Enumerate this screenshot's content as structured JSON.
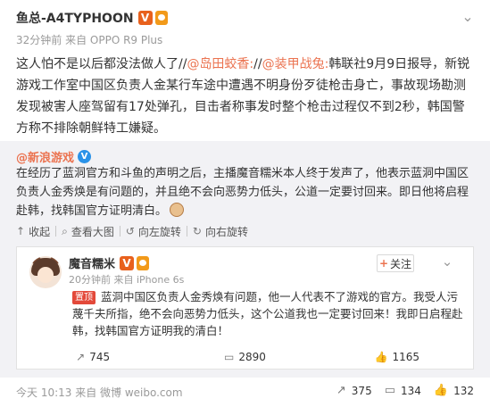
{
  "post": {
    "author": "鱼总-A4TYPHOON",
    "meta": "32分钟前 来自 OPPO R9 Plus",
    "text": {
      "intro": "这人怕不是以后都没法做人了//",
      "mention1": "@岛田蛟香:",
      "sep": "//",
      "mention2": "@装甲战兔:",
      "body": "韩联社9月9日报导，新锐游戏工作室中国区负责人金某行车途中遭遇不明身份歹徒枪击身亡，事故现场勘测发现被害人座驾留有17处弹孔，目击者称事发时整个枪击过程仅不到2秒，韩国警方称不排除朝鲜特工嫌疑。"
    }
  },
  "retweet": {
    "author": "@新浪游戏",
    "text": "在经历了蓝洞官方和斗鱼的声明之后，主播魔音糯米本人终于发声了，他表示蓝洞中国区负责人金秀焕是有问题的，并且绝不会向恶势力低头，公道一定要讨回来。即日他将启程赴韩，找韩国官方证明清白。",
    "toolbar": {
      "collapse": "收起",
      "view_large": "查看大图",
      "rotate_left": "向左旋转",
      "rotate_right": "向右旋转"
    },
    "embedded": {
      "author": "魔音糯米",
      "meta": "20分钟前 来自 iPhone 6s",
      "follow_label": "关注",
      "pinned_label": "置顶",
      "text": "蓝洞中国区负责人金秀焕有问题，他一人代表不了游戏的官方。我受人污蔑千夫所指，绝不会向恶势力低头，这个公道我也一定要讨回来！我即日启程赴韩，找韩国官方证明我的清白！",
      "actions": {
        "repost": "745",
        "comment": "2890",
        "like": "1165"
      }
    }
  },
  "footer": {
    "meta": "今天 10:13 来自 微博 weibo.com",
    "repost": "375",
    "comment": "134",
    "like": "132"
  },
  "icons": {
    "menu": "chevron-down-icon",
    "verified": "verified-v-icon",
    "vip": "vip-badge-icon",
    "repost": "repost-icon",
    "comment": "comment-icon",
    "like": "thumbs-up-icon"
  },
  "colors": {
    "accent": "#eb7350",
    "verified_orange": "#e8611d",
    "verified_blue": "#2a92e8",
    "retweet_bg": "#f2f2f5",
    "meta_text": "#9a9a9a",
    "pinned_red": "#e3493a"
  }
}
